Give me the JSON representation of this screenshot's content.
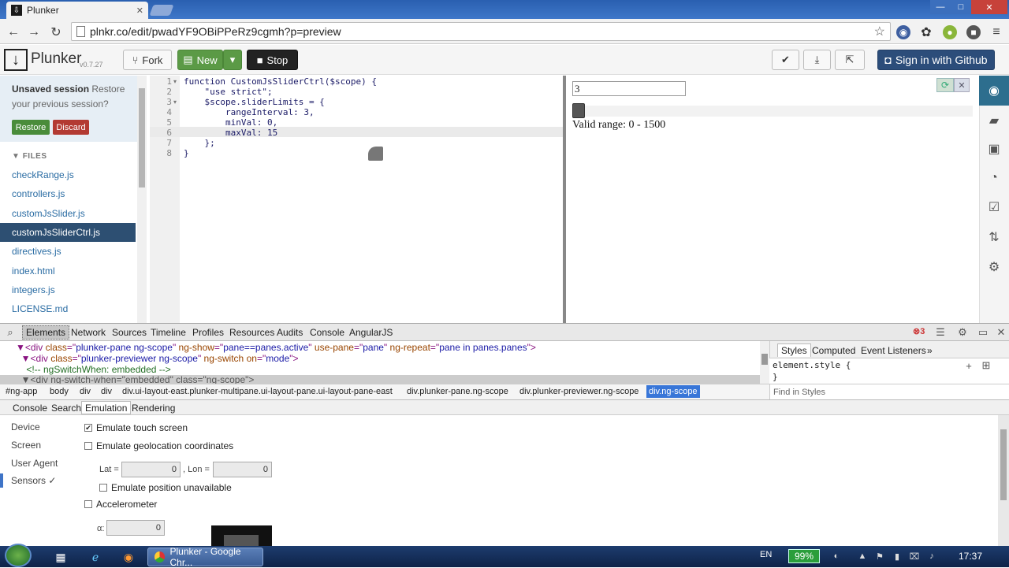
{
  "browser": {
    "tab_title": "Plunker",
    "url": "plnkr.co/edit/pwadYF9OBiPPeRz9cgmh?p=preview"
  },
  "plunker": {
    "logo_letter": "↓",
    "name": "Plunker",
    "version": "v0.7.27",
    "fork_label": "Fork",
    "new_label": "New",
    "stop_label": "Stop",
    "github_label": "Sign in with Github"
  },
  "session": {
    "bold": "Unsaved session",
    "text": " Restore your previous session?",
    "restore_label": "Restore",
    "discard_label": "Discard"
  },
  "files": {
    "header": "FILES",
    "items": [
      "checkRange.js",
      "controllers.js",
      "customJsSlider.js",
      "customJsSliderCtrl.js",
      "directives.js",
      "index.html",
      "integers.js",
      "LICENSE.md"
    ],
    "active_index": 3
  },
  "editor": {
    "line_numbers": [
      "1",
      "2",
      "3",
      "4",
      "5",
      "6",
      "7",
      "8"
    ],
    "lines": [
      "function CustomJsSliderCtrl($scope) {",
      "    \"use strict\";",
      "    $scope.sliderLimits = {",
      "        rangeInterval: 3,",
      "        minVal: 0,",
      "        maxVal: 15",
      "    };",
      "}"
    ]
  },
  "preview": {
    "input_value": "3",
    "valid_range_text": "Valid range: 0 - 1500"
  },
  "devtools": {
    "tabs": [
      "Elements",
      "Network",
      "Sources",
      "Timeline",
      "Profiles",
      "Resources",
      "Audits",
      "Console",
      "AngularJS"
    ],
    "error_count": "3",
    "dom_lines": [
      {
        "indent": "      ▼",
        "tag": "<div ",
        "attrs": [
          [
            "class",
            "plunker-pane ng-scope"
          ],
          [
            "ng-show",
            "pane==panes.active"
          ],
          [
            "use-pane",
            "pane"
          ],
          [
            "ng-repeat",
            "pane in panes.panes"
          ]
        ]
      },
      {
        "indent": "        ▼",
        "tag": "<div ",
        "attrs": [
          [
            "class",
            "plunker-previewer ng-scope"
          ],
          [
            "ng-switch",
            ""
          ],
          [
            "on",
            "mode"
          ]
        ]
      }
    ],
    "dom_comment": "          <!-- ngSwitchWhen: embedded -->",
    "dom_selected": "        ▼<div ng-switch-when=\"embedded\" class=\"ng-scope\">",
    "styles_tabs": [
      "Styles",
      "Computed",
      "Event Listeners",
      "»"
    ],
    "element_style": "element.style {",
    "element_style_close": "}",
    "find_in_styles": "Find in Styles",
    "breadcrumbs": [
      "#ng-app",
      "body",
      "div",
      "div",
      "div.ui-layout-east.plunker-multipane.ui-layout-pane.ui-layout-pane-east",
      "div.plunker-pane.ng-scope",
      "div.plunker-previewer.ng-scope",
      "div.ng-scope"
    ],
    "drawer_tabs": [
      "Console",
      "Search",
      "Emulation",
      "Rendering"
    ],
    "emulation": {
      "side": [
        "Device",
        "Screen",
        "User Agent",
        "Sensors ✓"
      ],
      "touch_label": "Emulate touch screen",
      "geo_label": "Emulate geolocation coordinates",
      "lat_label": "Lat =",
      "lat_value": "0",
      "lon_label": ", Lon =",
      "lon_value": "0",
      "pos_unavail_label": "Emulate position unavailable",
      "accel_label": "Accelerometer",
      "alpha_label": "α:",
      "alpha_value": "0"
    }
  },
  "taskbar": {
    "chrome_label": "Plunker - Google Chr...",
    "lang": "EN",
    "battery": "99%",
    "clock": "17:37"
  }
}
